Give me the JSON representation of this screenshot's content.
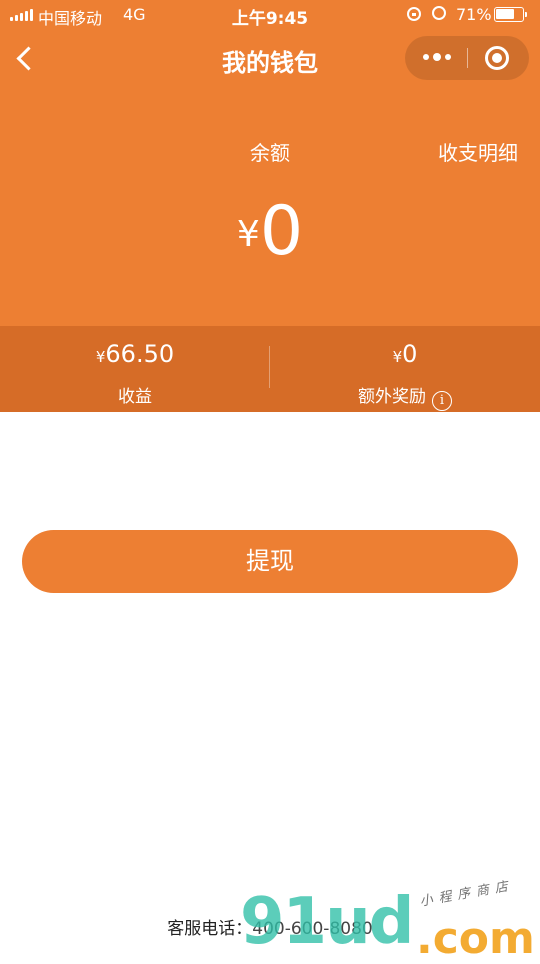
{
  "status_bar": {
    "carrier": "中国移动",
    "network": "4G",
    "time": "上午9:45",
    "battery_percent": "71%",
    "battery_level": 0.71
  },
  "nav": {
    "title": "我的钱包",
    "back_icon": "chevron-left-icon",
    "more_icon": "more-dots-icon",
    "close_icon": "target-close-icon"
  },
  "balance": {
    "label": "余额",
    "details_link": "收支明细",
    "currency": "¥",
    "amount": "0"
  },
  "stats": {
    "earnings": {
      "currency": "¥",
      "value": "66.50",
      "label": "收益"
    },
    "bonus": {
      "currency": "¥",
      "value": "0",
      "label": "额外奖励",
      "info_icon": "i"
    }
  },
  "withdraw_button": "提现",
  "footer": {
    "service_label": "客服电话：",
    "service_phone": "400-600-8080"
  },
  "watermark": {
    "digits": "91ud",
    "domain": ".com",
    "tagline": "小程序商店"
  },
  "colors": {
    "primary": "#ED7F33",
    "stats_band": "#D66C27",
    "watermark_teal": "#2FBFA7",
    "watermark_orange": "#F3A421"
  }
}
